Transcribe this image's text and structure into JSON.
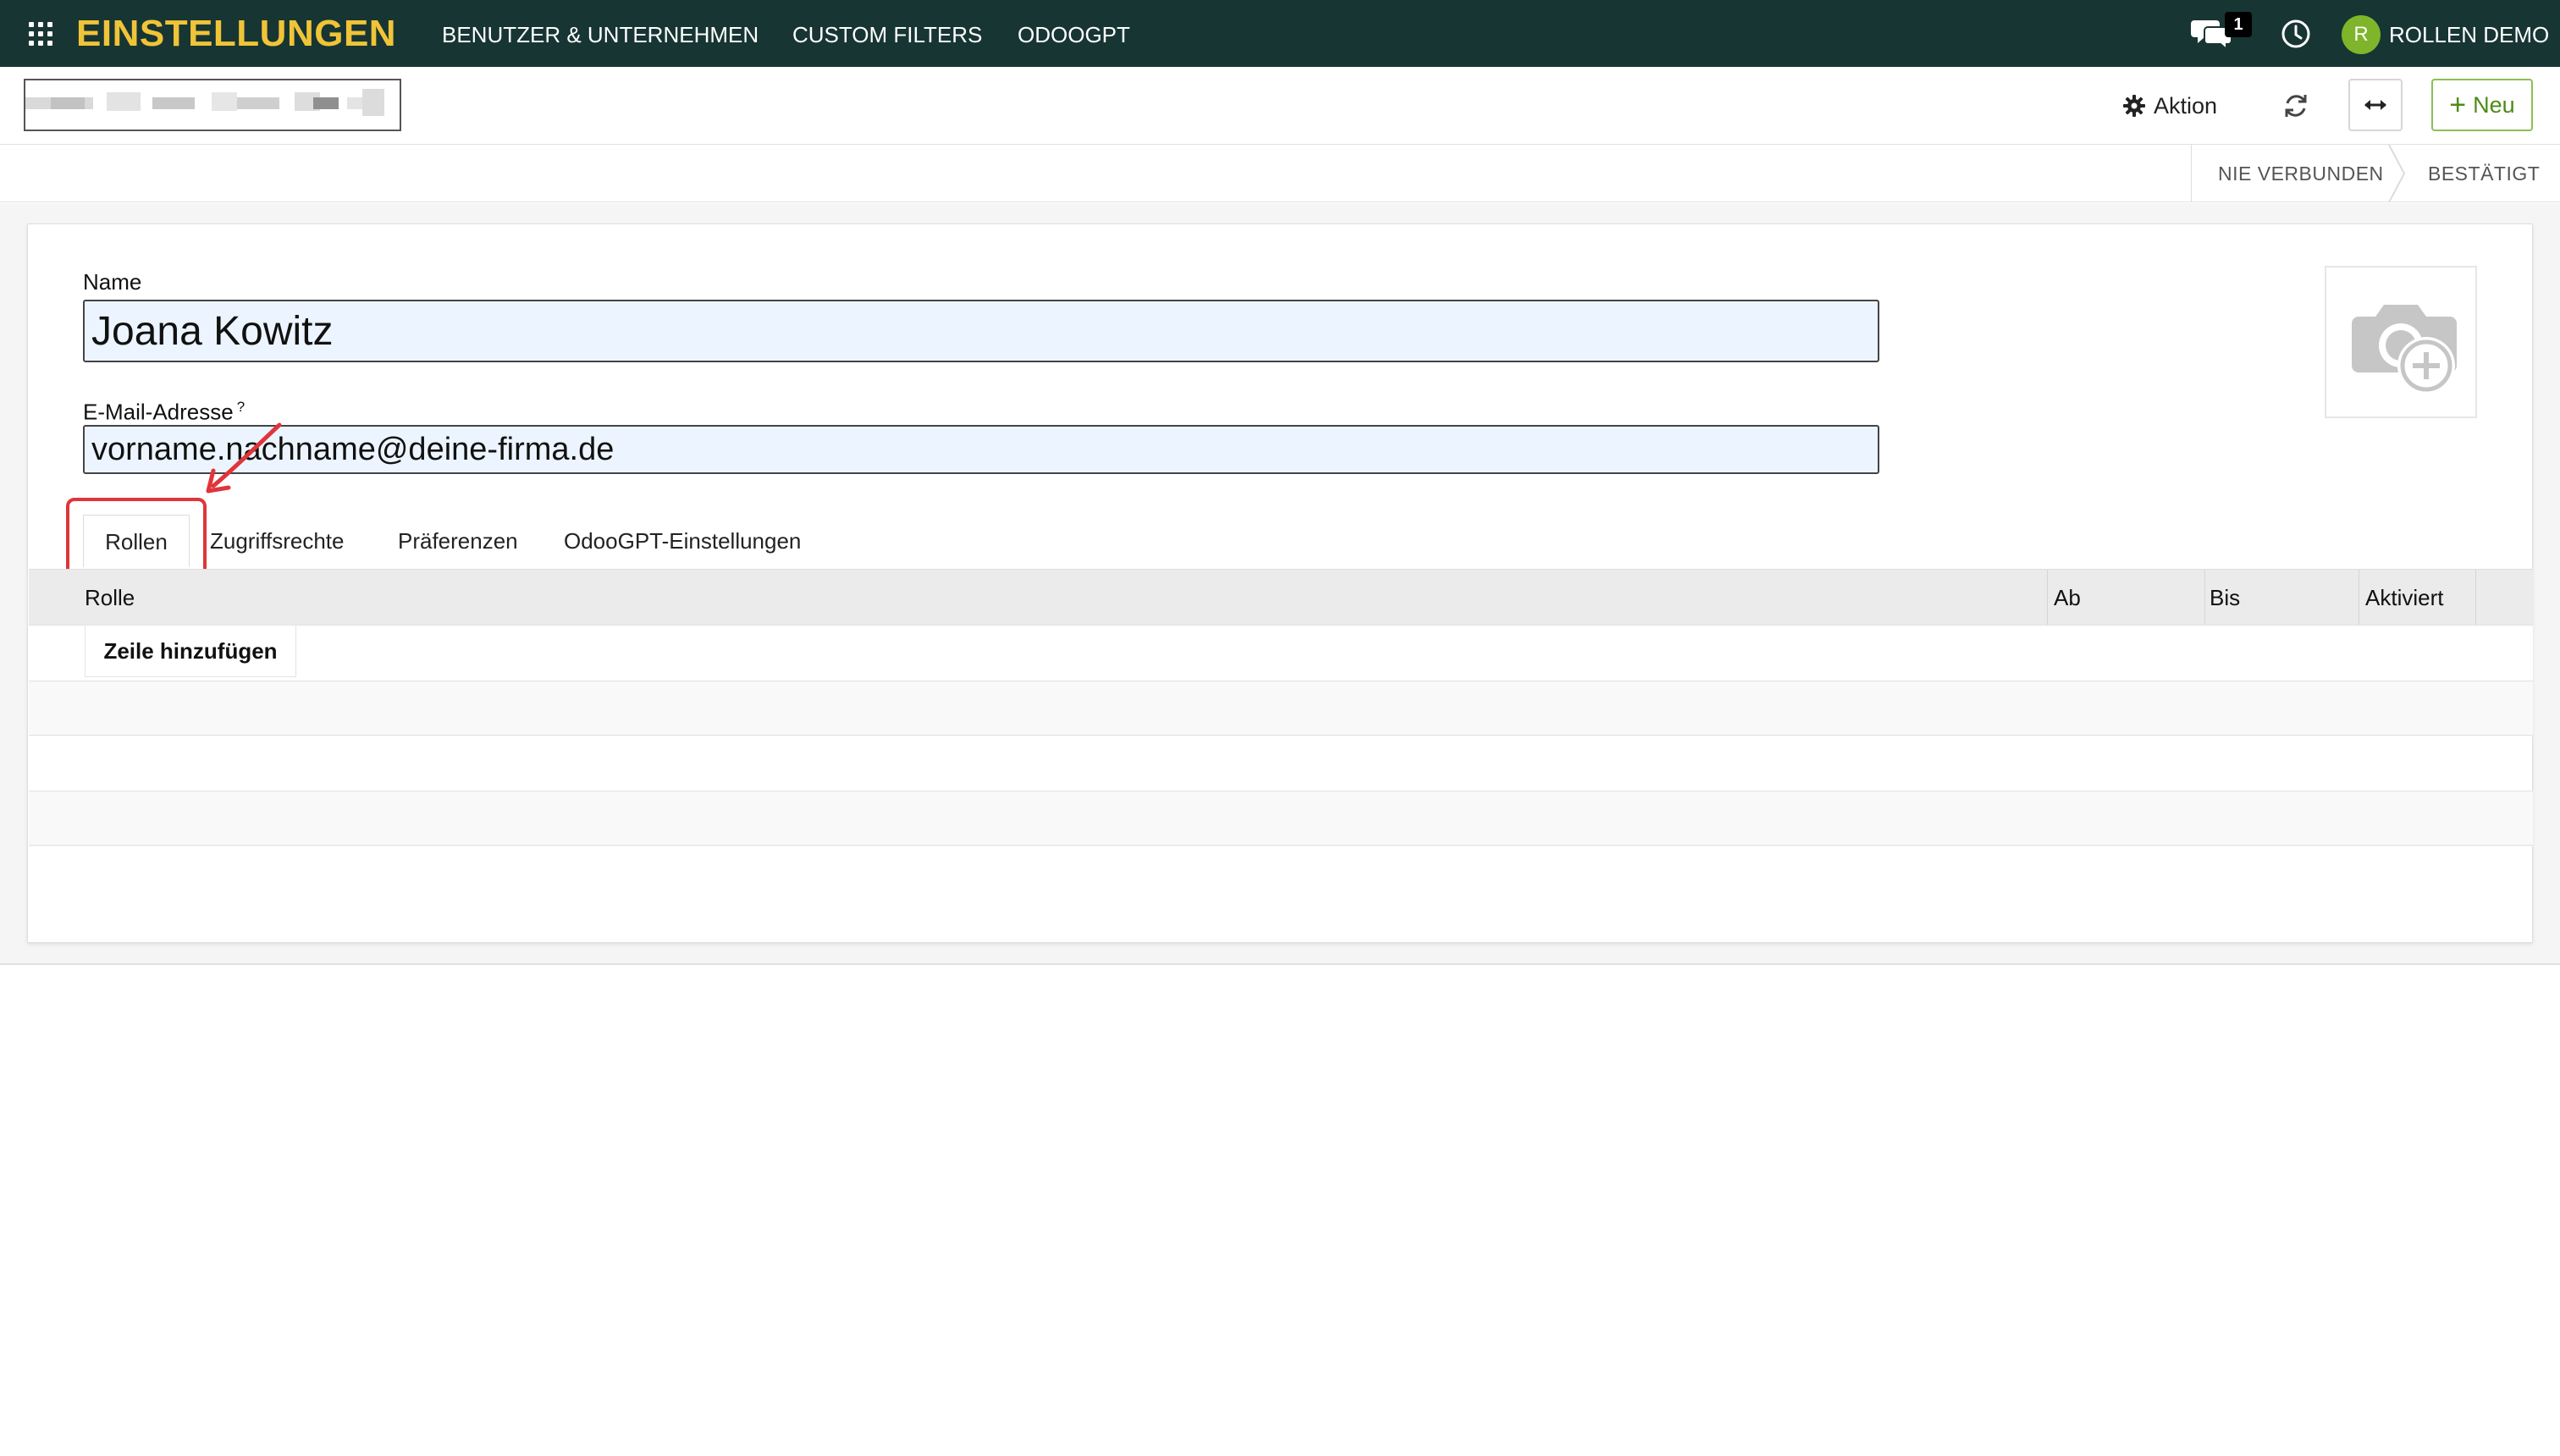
{
  "navbar": {
    "brand": "EINSTELLUNGEN",
    "menu": [
      "BENUTZER & UNTERNEHMEN",
      "CUSTOM FILTERS",
      "ODOOGPT"
    ],
    "chat_count": "1",
    "avatar_initial": "R",
    "user_name": "ROLLEN DEMO",
    "bg_color": "#173533",
    "brand_color": "#f0c437"
  },
  "control": {
    "action_label": "Aktion",
    "new_label": "Neu",
    "icons": [
      "gear-icon",
      "reload-icon",
      "expand-icon",
      "plus-icon"
    ]
  },
  "status": {
    "steps": [
      "NIE VERBUNDEN",
      "BESTÄTIGT"
    ]
  },
  "form": {
    "name_label": "Name",
    "name_value": "Joana Kowitz",
    "email_label": "E-Mail-Adresse",
    "email_help": "?",
    "email_value": "vorname.nachname@deine-firma.de"
  },
  "tabs": [
    "Rollen",
    "Zugriffsrechte",
    "Präferenzen",
    "OdooGPT-Einstellungen"
  ],
  "table": {
    "columns": [
      "Rolle",
      "Ab",
      "Bis",
      "Aktiviert"
    ],
    "add_line": "Zeile hinzufügen"
  },
  "annotation": {
    "highlight_color": "#e0353a"
  }
}
